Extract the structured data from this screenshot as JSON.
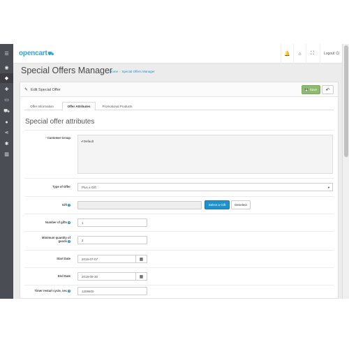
{
  "sidebar": {
    "items": [
      {
        "icon": "menu-icon",
        "glyph": "☰"
      },
      {
        "icon": "dashboard-icon",
        "glyph": "◉"
      },
      {
        "icon": "tag-icon",
        "glyph": "◆"
      },
      {
        "icon": "puzzle-icon",
        "glyph": "✚"
      },
      {
        "icon": "desktop-icon",
        "glyph": "▭"
      },
      {
        "icon": "cart-icon",
        "glyph": "⛟"
      },
      {
        "icon": "user-icon",
        "glyph": "●"
      },
      {
        "icon": "share-icon",
        "glyph": "⋖"
      },
      {
        "icon": "cog-icon",
        "glyph": "✱"
      },
      {
        "icon": "bar-chart-icon",
        "glyph": "▥"
      }
    ]
  },
  "header": {
    "logo": "opencart",
    "logo_mark": "⛟",
    "bell_glyph": "🔔",
    "home_glyph": "⌂",
    "expand_glyph": "⛶",
    "logout": "Logout",
    "logout_glyph": "⏻"
  },
  "page": {
    "title": "Special Offers Manager",
    "breadcrumb": [
      "Home",
      "Special Offers Manager"
    ],
    "breadcrumb_sep": "›"
  },
  "panel": {
    "title": "Edit Special Offer",
    "pencil_glyph": "✎",
    "save_icon": "💾",
    "save_label": "Save",
    "back_glyph": "↶"
  },
  "tabs": [
    {
      "label": "Offer Information",
      "active": false
    },
    {
      "label": "Offer Attributes",
      "active": true
    },
    {
      "label": "Promotional Products",
      "active": false
    }
  ],
  "section_title": "Special offer attributes",
  "form": {
    "customer_group": {
      "label": "Customer Group",
      "required_mark": "*",
      "options": [
        {
          "label": "Default",
          "checked": true
        }
      ],
      "check_glyph": "✔"
    },
    "type_of_offer": {
      "label": "Type of Offer",
      "value": "Plus a Gift"
    },
    "gift": {
      "label": "Gift",
      "value": "",
      "select_label": "Select a Gift",
      "deselect_label": "Deselect"
    },
    "number_of_gifts": {
      "label": "Number of gifts",
      "value": "1"
    },
    "min_quantity": {
      "label_line1": "Minimum quantity of",
      "label_line2": "goods",
      "value": "2"
    },
    "start_date": {
      "label": "Start Date",
      "value": "2019-07-07"
    },
    "end_date": {
      "label": "End Date",
      "value": "2019-09-30"
    },
    "timer": {
      "label": "Timer restart cycle, sec",
      "value": "1209600"
    },
    "help_glyph": "?",
    "calendar_glyph": "▦",
    "caret_glyph": "▼"
  }
}
